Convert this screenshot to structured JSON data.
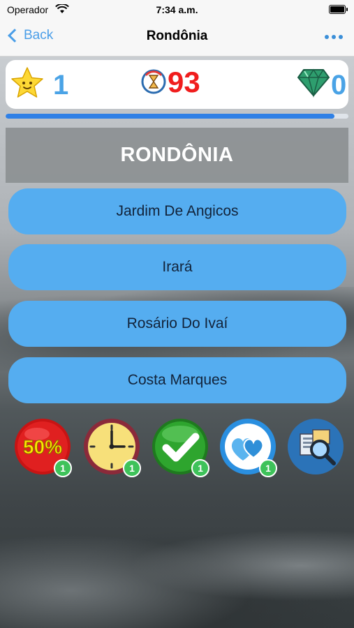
{
  "status_bar": {
    "carrier": "Operador",
    "time": "7:34 a.m."
  },
  "nav": {
    "back_label": "Back",
    "title": "Rondônia"
  },
  "score": {
    "stars": "1",
    "timer": "93",
    "gems": "0"
  },
  "progress": {
    "value_percent": 96
  },
  "question": {
    "text": "RONDÔNIA"
  },
  "answers": [
    {
      "label": "Jardim De Angicos"
    },
    {
      "label": "Irará"
    },
    {
      "label": "Rosário Do Ivaí"
    },
    {
      "label": "Costa Marques"
    }
  ],
  "powerups": [
    {
      "name": "fifty-fifty",
      "label": "50%",
      "count": "1"
    },
    {
      "name": "extra-time",
      "count": "1"
    },
    {
      "name": "correct-answer",
      "count": "1"
    },
    {
      "name": "extra-life",
      "count": "1"
    },
    {
      "name": "search-hint"
    }
  ],
  "colors": {
    "accent": "#4a9ee8",
    "answer_bg": "#55adf0",
    "timer": "#f01d1d",
    "badge": "#3ec25a"
  }
}
